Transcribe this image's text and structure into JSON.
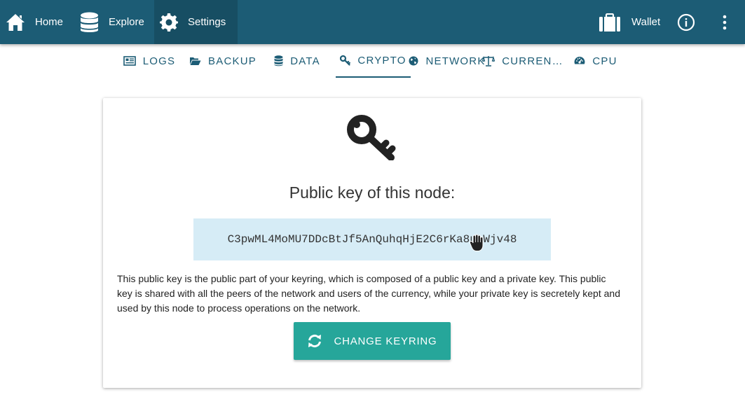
{
  "topbar": {
    "home_label": "Home",
    "explore_label": "Explore",
    "settings_label": "Settings",
    "wallet_label": "Wallet",
    "icons": {
      "home": "home-icon",
      "explore": "database-icon",
      "settings": "gear-icon",
      "wallet": "suitcase-icon",
      "info": "info-icon",
      "more": "more-vert-icon"
    },
    "colors": {
      "bar": "#1c5c75",
      "active": "#174e63"
    }
  },
  "tabs": [
    {
      "label": "LOGS",
      "icon": "newspaper-icon"
    },
    {
      "label": "BACKUP",
      "icon": "folder-open-icon"
    },
    {
      "label": "DATA",
      "icon": "database-icon"
    },
    {
      "label": "CRYPTO",
      "icon": "key-icon",
      "active": true
    },
    {
      "label": "NETWORK",
      "icon": "globe-icon"
    },
    {
      "label": "CURREN…",
      "icon": "balance-scale-icon"
    },
    {
      "label": "CPU",
      "icon": "dashboard-icon"
    }
  ],
  "crypto": {
    "title": "Public key of this node:",
    "public_key": "C3pwML4MoMU7DDcBtJf5AnQuhqHjE2C6rKa8uLWjv48",
    "description": "This public key is the public part of your keyring, which is composed of a public key and a private key. This public key is shared with all the peers of the network and users of the currency, while your private key is secretely kept and used by this node to process operations on the network.",
    "change_button_label": "CHANGE KEYRING",
    "colors": {
      "key_box": "#d6ecf6",
      "button": "#26a69a"
    }
  }
}
